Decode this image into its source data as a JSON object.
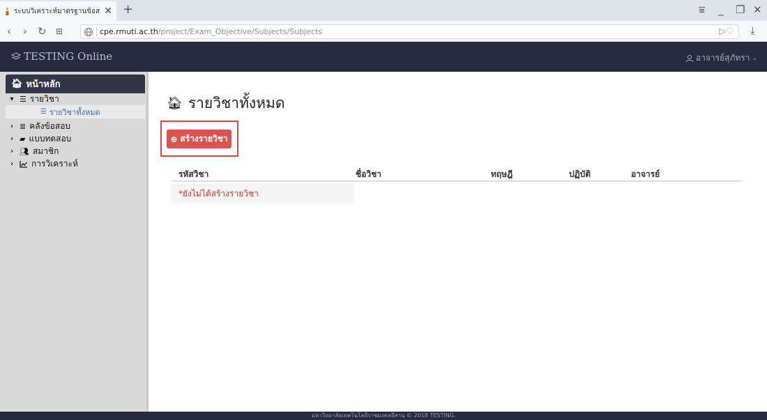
{
  "browser": {
    "tab_title": "ระบบวิเคราะห์มาตรฐานข้อสอบ",
    "url_host": "cpe.rmuti.ac.th",
    "url_path": "/project/Exam_Objective/Subjects/Subjects"
  },
  "navbar": {
    "brand": "TESTING Online",
    "user": "อาจารย์สุภัทรา"
  },
  "sidebar": {
    "home": "หน้าหลัก",
    "items": [
      {
        "label": "รายวิชา",
        "icon": "list-icon"
      },
      {
        "label": "คลังข้อสอบ",
        "icon": "database-icon"
      },
      {
        "label": "แบบทดสอบ",
        "icon": "book-icon"
      },
      {
        "label": "สมาชิก",
        "icon": "users-icon"
      },
      {
        "label": "การวิเคราะห์",
        "icon": "line-chart-icon"
      }
    ],
    "sub_item": "รายวิชาทั้งหมด"
  },
  "main": {
    "title": "รายวิชาทั้งหมด",
    "create_button": "สร้างรายวิชา",
    "columns": [
      "รหัสวิชา",
      "ชื่อวิชา",
      "ทฤษฎี",
      "ปฏิบัติ",
      "อาจารย์"
    ],
    "empty_message": "*ยังไม่ได้สร้างรายวิชา"
  },
  "footer": "มหาวิทยาลัยเทคโนโลยีราชมงคลอีสาน © 2018 TESTING.",
  "colors": {
    "navbar": "#252a3d",
    "sidebar": "#d9d9d9",
    "danger": "#d9534f",
    "link": "#3c6fbd"
  }
}
